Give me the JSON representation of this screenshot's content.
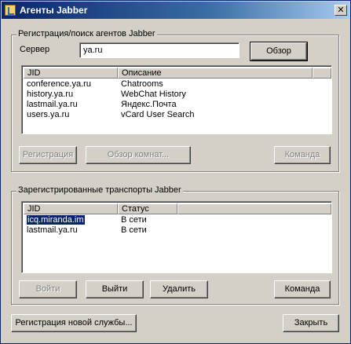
{
  "window": {
    "title": "Агенты Jabber",
    "close_glyph": "✕"
  },
  "search_group": {
    "legend": "Регистрация/поиск агентов Jabber",
    "server_label": "Сервер",
    "server_value": "ya.ru",
    "browse_label": "Обзор",
    "columns": [
      "JID",
      "Описание"
    ],
    "rows": [
      {
        "jid": "conference.ya.ru",
        "desc": "Chatrooms"
      },
      {
        "jid": "history.ya.ru",
        "desc": "WebChat History"
      },
      {
        "jid": "lastmail.ya.ru",
        "desc": "Яндекс.Почта"
      },
      {
        "jid": "users.ya.ru",
        "desc": "vCard User Search"
      }
    ],
    "register_label": "Регистрация",
    "browse_rooms_label": "Обзор комнат...",
    "command_label": "Команда"
  },
  "transports_group": {
    "legend": "Зарегистрированные транспорты Jabber",
    "columns": [
      "JID",
      "Статус"
    ],
    "rows": [
      {
        "jid": "icq.miranda.im",
        "status": "В сети"
      },
      {
        "jid": "lastmail.ya.ru",
        "status": "В сети"
      }
    ],
    "login_label": "Войти",
    "logout_label": "Выйти",
    "delete_label": "Удалить",
    "command_label": "Команда"
  },
  "footer": {
    "register_new_label": "Регистрация новой службы...",
    "close_label": "Закрыть"
  }
}
